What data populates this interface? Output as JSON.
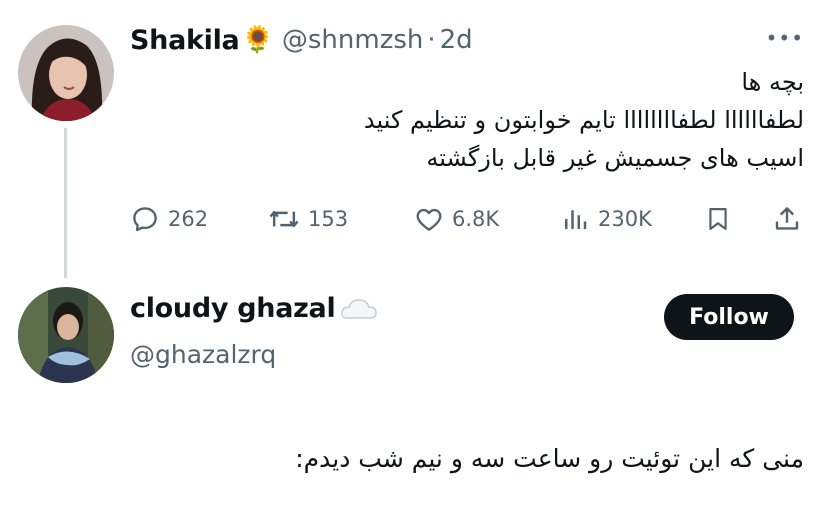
{
  "tweet1": {
    "author_name": "Shakila",
    "author_emoji": "🌻",
    "handle": "@shnmzsh",
    "separator": "·",
    "time": "2d",
    "lines": [
      "بچه ها",
      "لطفاااااا لطفاااااااا تایم خوابتون و تنظیم کنید",
      "اسیب های جسمیش غیر قابل بازگشته"
    ],
    "stats": {
      "replies": "262",
      "reposts": "153",
      "likes": "6.8K",
      "views": "230K"
    },
    "icons": {
      "reply": "reply-icon",
      "repost": "repost-icon",
      "like": "heart-icon",
      "views": "views-icon",
      "bookmark": "bookmark-icon",
      "share": "share-icon",
      "more": "more-icon"
    }
  },
  "tweet2": {
    "author_name": "cloudy ghazal",
    "author_emoji_icon": "cloud-icon",
    "handle": "@ghazalzrq",
    "follow_label": "Follow",
    "text": "منی که این توئیت رو ساعت سه و نیم شب دیدم:"
  },
  "colors": {
    "text": "#0f1419",
    "muted": "#536471",
    "thread_line": "#cfd9de",
    "follow_bg": "#0f1419",
    "follow_text": "#ffffff"
  }
}
